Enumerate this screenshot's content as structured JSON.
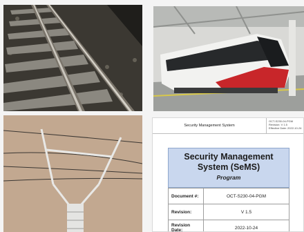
{
  "tiles": [
    {
      "name": "railway-track-photo"
    },
    {
      "name": "light-rail-train-photo"
    },
    {
      "name": "overhead-catenary-photo"
    },
    {
      "name": "document-cover-photo"
    }
  ],
  "document": {
    "header_title": "Security Management System",
    "header_meta_1": "OCT-S230-04-PGM",
    "header_meta_2": "Revision: V 1.5",
    "header_meta_3": "Effective Date: 2022-10-24",
    "title": "Security Management System (SeMS)",
    "subtitle": "Program",
    "rows": [
      {
        "label": "Document #:",
        "value": "OCT-S230-04-PGM"
      },
      {
        "label": "Revision:",
        "value": "V 1.5"
      },
      {
        "label": "Revision Date:",
        "value": "2022-10-24"
      }
    ]
  }
}
